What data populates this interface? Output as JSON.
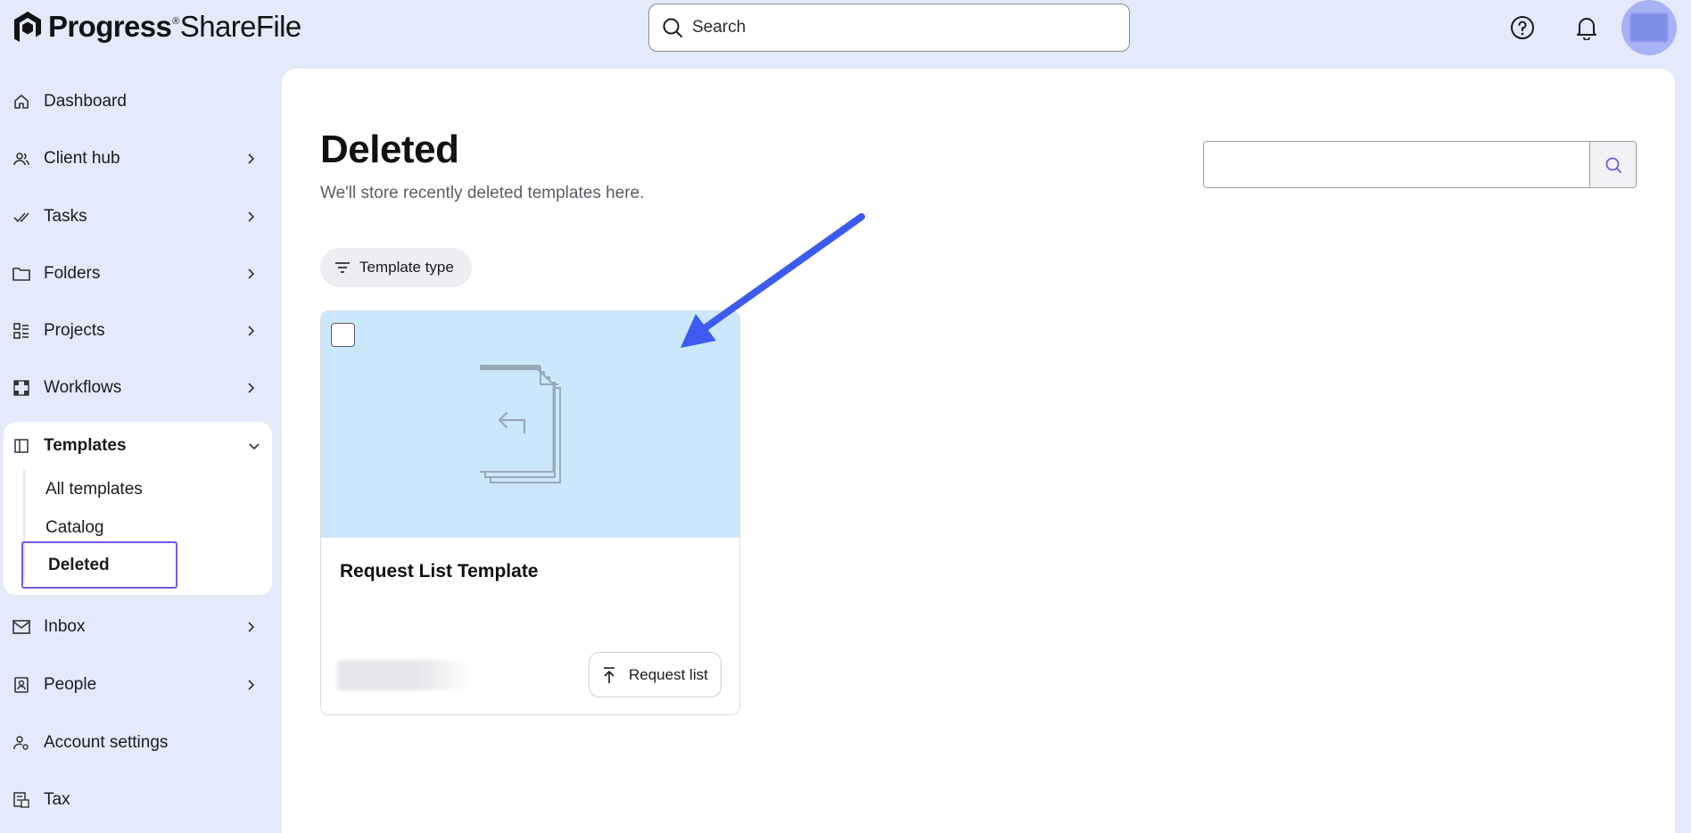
{
  "brand": {
    "name_primary": "Progress",
    "registered_mark": "®",
    "name_secondary": "ShareFile"
  },
  "header": {
    "search_placeholder": "Search",
    "help_icon": "help-circle-icon",
    "notifications_icon": "bell-icon"
  },
  "sidebar": {
    "items": [
      {
        "label": "Dashboard",
        "icon": "home-icon",
        "has_chevron": false
      },
      {
        "label": "Client hub",
        "icon": "users-icon",
        "has_chevron": true
      },
      {
        "label": "Tasks",
        "icon": "check-icon",
        "has_chevron": true
      },
      {
        "label": "Folders",
        "icon": "folder-icon",
        "has_chevron": true
      },
      {
        "label": "Projects",
        "icon": "projects-icon",
        "has_chevron": true
      },
      {
        "label": "Workflows",
        "icon": "workflow-icon",
        "has_chevron": true
      },
      {
        "label": "Inbox",
        "icon": "mail-icon",
        "has_chevron": true
      },
      {
        "label": "People",
        "icon": "contact-icon",
        "has_chevron": true
      },
      {
        "label": "Account settings",
        "icon": "account-settings-icon",
        "has_chevron": false
      },
      {
        "label": "Tax",
        "icon": "tax-icon",
        "has_chevron": false
      }
    ],
    "templates": {
      "label": "Templates",
      "sub_items": [
        "All templates",
        "Catalog"
      ],
      "active_item": "Deleted"
    }
  },
  "main": {
    "title": "Deleted",
    "subtitle": "We'll store recently deleted templates here.",
    "filter_chip": "Template type",
    "card": {
      "title": "Request List Template",
      "action_label": "Request list"
    }
  },
  "colors": {
    "background": "#e4e9fb",
    "accent": "#6c5ce7",
    "card_preview": "#cbe7fb",
    "annotation_arrow": "#3d5bf0"
  }
}
